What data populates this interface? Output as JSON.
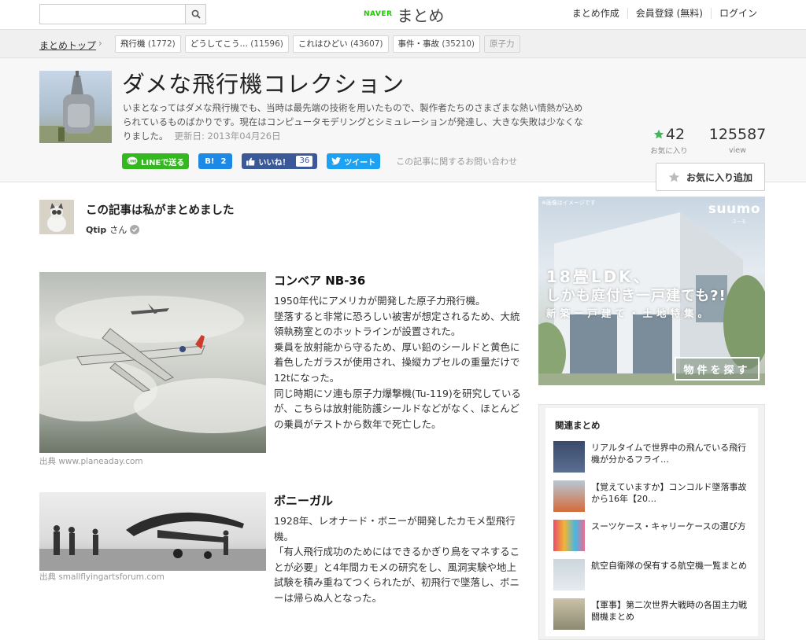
{
  "header": {
    "search_placeholder": "",
    "logo_naver": "NAVER",
    "logo_matome": "まとめ",
    "links": [
      "まとめ作成",
      "会員登録 (無料)",
      "ログイン"
    ]
  },
  "breadcrumb": {
    "top": "まとめトップ",
    "separator": ">",
    "tags": [
      {
        "label": "飛行機",
        "count": "(1772)"
      },
      {
        "label": "どうしてこう…",
        "count": "(11596)"
      },
      {
        "label": "これはひどい",
        "count": "(43607)"
      },
      {
        "label": "事件・事故",
        "count": "(35210)"
      },
      {
        "label": "原子力",
        "count": ""
      }
    ]
  },
  "article": {
    "title": "ダメな飛行機コレクション",
    "description": "いまとなってはダメな飛行機でも、当時は最先端の技術を用いたもので、製作者たちのさまざまな熱い情熱が込められているものばかりです。現在はコンピュータモデリングとシミュレーションが発達し、大きな失敗は少なくなりました。",
    "updated": "更新日: 2013年04月26日",
    "favorites_count": "42",
    "favorites_label": "お気に入り",
    "views_count": "125587",
    "views_label": "view",
    "add_favorite_label": "お気に入り追加"
  },
  "social": {
    "line": "LINEで送る",
    "hatena_label": "B!",
    "hatena_count": "2",
    "facebook_label": "いいね！",
    "facebook_count": "36",
    "tweet": "ツイート",
    "inquiry": "この記事に関するお問い合わせ"
  },
  "author": {
    "heading": "この記事は私がまとめました",
    "name": "Qtip",
    "suffix": "さん"
  },
  "items": [
    {
      "title": "コンベア NB-36",
      "body": "1950年代にアメリカが開発した原子力飛行機。\n墜落すると非常に恐ろしい被害が想定されるため、大統領執務室とのホットラインが設置された。\n乗員を放射能から守るため、厚い鉛のシールドと黄色に着色したガラスが使用され、操縦カプセルの重量だけで12tになった。\n同じ時期にソ連も原子力爆撃機(Tu-119)を研究しているが、こちらは放射能防護シールドなどがなく、ほとんどの乗員がテストから数年で死亡した。",
      "source": "出典 www.planeaday.com"
    },
    {
      "title": "ボニーガル",
      "body": "1928年、レオナード・ボニーが開発したカモメ型飛行機。\n「有人飛行成功のためにはできるかぎり鳥をマネすることが必要」と4年間カモメの研究をし、風洞実験や地上試験を積み重ねてつくられたが、初飛行で墜落し、ボニーは帰らぬ人となった。",
      "source": "出典 smallflyingartsforum.com"
    }
  ],
  "ad": {
    "note": "※画像はイメージです",
    "logo": "suumo",
    "logo_sub": "スーモ",
    "line1": "18畳LDK、",
    "line2": "しかも庭付き一戸建ても?!",
    "line3": "新築一戸建て・土地特集。",
    "button": "物件を探す"
  },
  "related": {
    "title": "関連まとめ",
    "items": [
      "リアルタイムで世界中の飛んでいる飛行機が分かるフライ…",
      "【覚えていますか】コンコルド墜落事故から16年【20…",
      "スーツケース・キャリーケースの選び方",
      "航空自衛隊の保有する航空機一覧まとめ",
      "【軍事】第二次世界大戦時の各国主力戦闘機まとめ"
    ]
  },
  "colors": {
    "naver_green": "#1ec800",
    "line_green": "#34b81f",
    "hatena_blue": "#1e88e5",
    "facebook_blue": "#3b5998",
    "twitter_blue": "#1da1f2",
    "star_green": "#44b55b"
  }
}
